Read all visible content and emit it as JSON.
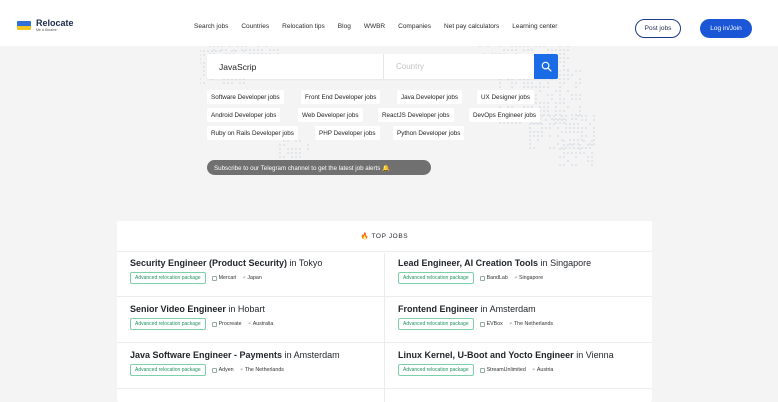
{
  "brand": {
    "name": "Relocate",
    "tagline": "Me a Ukraine"
  },
  "nav": [
    "Search jobs",
    "Countries",
    "Relocation tips",
    "Blog",
    "WWBR",
    "Companies",
    "Net pay calculators",
    "Learning center"
  ],
  "header_buttons": {
    "post": "Post jobs",
    "login": "Log in/Join"
  },
  "search": {
    "query": "JavaScrip",
    "country_placeholder": "Country"
  },
  "chips": [
    [
      "Software Developer jobs",
      "Front End Developer jobs",
      "Java Developer jobs",
      "UX Designer jobs"
    ],
    [
      "Android Developer jobs",
      "Web Developer jobs",
      "ReactJS Developer jobs",
      "DevOps Engineer jobs"
    ],
    [
      "Ruby on Rails Developer jobs",
      "PHP Developer jobs",
      "Python Developer jobs"
    ]
  ],
  "telegram_banner": "Subscribe to our Telegram channel to get the latest job alerts 🔔",
  "top_jobs": {
    "heading": "TOP JOBS",
    "jobs": [
      {
        "title": "Security Engineer (Product Security)",
        "in": "in",
        "city": "Tokyo",
        "package": "Advanced relocation package",
        "company": "Mercari",
        "country": "Japan"
      },
      {
        "title": "Lead Engineer, AI Creation Tools",
        "in": "in",
        "city": "Singapore",
        "package": "Advanced relocation package",
        "company": "BandLab",
        "country": "Singapore"
      },
      {
        "title": "Senior Video Engineer",
        "in": "in",
        "city": "Hobart",
        "package": "Advanced relocation package",
        "company": "Procreate",
        "country": "Australia"
      },
      {
        "title": "Frontend Engineer",
        "in": "in",
        "city": "Amsterdam",
        "package": "Advanced relocation package",
        "company": "EVBox",
        "country": "The Netherlands"
      },
      {
        "title": "Java Software Engineer - Payments",
        "in": "in",
        "city": "Amsterdam",
        "package": "Advanced relocation package",
        "company": "Adyen",
        "country": "The Netherlands"
      },
      {
        "title": "Linux Kernel, U-Boot and Yocto Engineer",
        "in": "in",
        "city": "Vienna",
        "package": "Advanced relocation package",
        "company": "StreamUnlimited",
        "country": "Austria"
      }
    ]
  },
  "colors": {
    "primary": "#1a56d6",
    "search_button": "#1a6be6",
    "package_green": "#1f9460",
    "fire": "#f06a1b"
  }
}
